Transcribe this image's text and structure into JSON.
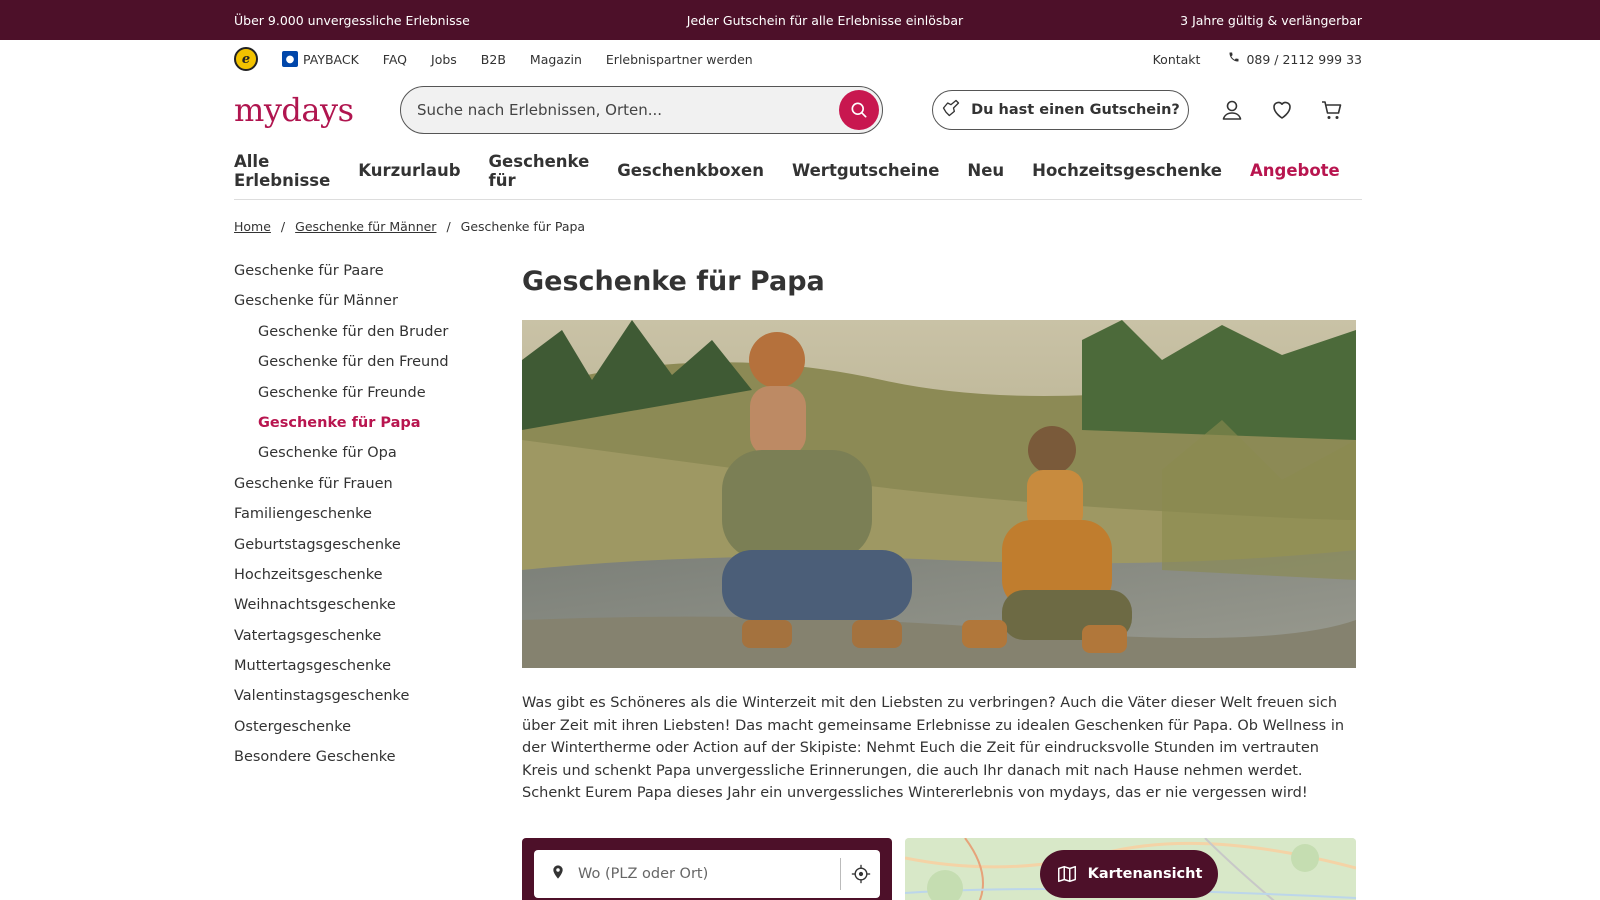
{
  "topbar": {
    "left": "Über 9.000 unvergessliche Erlebnisse",
    "center": "Jeder Gutschein für alle Erlebnisse einlösbar",
    "right": "3 Jahre gültig & verlängerbar"
  },
  "util": {
    "trusted_badge": "e",
    "payback": "PAYBACK",
    "links": [
      "FAQ",
      "Jobs",
      "B2B",
      "Magazin",
      "Erlebnispartner werden"
    ],
    "contact": "Kontakt",
    "phone": "089 / 2112 999 33"
  },
  "header": {
    "logo": "mydays",
    "search_placeholder": "Suche nach Erlebnissen, Orten...",
    "voucher_label": "Du hast einen Gutschein?"
  },
  "nav": {
    "items": [
      "Alle Erlebnisse",
      "Kurzurlaub",
      "Geschenke für",
      "Geschenkboxen",
      "Wertgutscheine",
      "Neu",
      "Hochzeitsgeschenke"
    ],
    "promo": "Angebote"
  },
  "breadcrumb": {
    "home": "Home",
    "parent": "Geschenke für Männer",
    "sep": "/",
    "current": "Geschenke für Papa"
  },
  "sidebar": {
    "items": [
      {
        "label": "Geschenke für Paare",
        "level": 0
      },
      {
        "label": "Geschenke für Männer",
        "level": 0
      },
      {
        "label": "Geschenke für den Bruder",
        "level": 1
      },
      {
        "label": "Geschenke für den Freund",
        "level": 1
      },
      {
        "label": "Geschenke für Freunde",
        "level": 1
      },
      {
        "label": "Geschenke für Papa",
        "level": 1,
        "active": true
      },
      {
        "label": "Geschenke für Opa",
        "level": 1
      },
      {
        "label": "Geschenke für Frauen",
        "level": 0
      },
      {
        "label": "Familiengeschenke",
        "level": 0
      },
      {
        "label": "Geburtstagsgeschenke",
        "level": 0
      },
      {
        "label": "Hochzeitsgeschenke",
        "level": 0
      },
      {
        "label": "Weihnachtsgeschenke",
        "level": 0
      },
      {
        "label": "Vatertagsgeschenke",
        "level": 0
      },
      {
        "label": "Muttertagsgeschenke",
        "level": 0
      },
      {
        "label": "Valentinstagsgeschenke",
        "level": 0
      },
      {
        "label": "Ostergeschenke",
        "level": 0
      },
      {
        "label": "Besondere Geschenke",
        "level": 0
      }
    ]
  },
  "main": {
    "title": "Geschenke für Papa",
    "intro": "Was gibt es Schöneres als die Winterzeit mit den Liebsten zu verbringen? Auch die Väter dieser Welt freuen sich über Zeit mit ihren Liebsten! Das macht gemeinsame Erlebnisse zu idealen Geschenken für Papa. Ob Wellness in der Wintertherme oder Action auf der Skipiste: Nehmt Euch die Zeit für eindrucksvolle Stunden im vertrauten Kreis und schenkt Papa unvergessliche Erinnerungen, die auch Ihr danach mit nach Hause nehmen werdet. Schenkt Eurem Papa dieses Jahr ein unvergessliches Wintererlebnis von mydays, das er nie vergessen wird!",
    "location_placeholder": "Wo (PLZ oder Ort)",
    "map_button": "Kartenansicht"
  },
  "colors": {
    "brand_dark": "#4d1029",
    "accent": "#c8174f"
  }
}
